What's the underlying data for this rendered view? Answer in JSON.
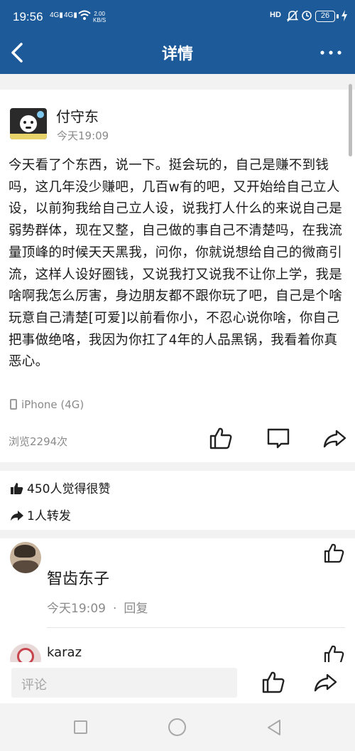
{
  "status_bar": {
    "time": "19:56",
    "signal1": "4G",
    "signal2": "4G",
    "net_speed_value": "2.00",
    "net_speed_unit": "KB/S",
    "hd": "HD",
    "battery": "26"
  },
  "header": {
    "title": "详情"
  },
  "post": {
    "author": "付守东",
    "time": "今天19:09",
    "content": "今天看了个东西，说一下。挺会玩的，自己是赚不到钱吗，这几年没少赚吧，几百w有的吧，又开始给自己立人设，以前狗我给自己立人设，说我打人什么的来说自己是弱势群体，现在又整，自己做的事自己不清楚吗，在我流量顶峰的时候天天黑我，问你，你就说想给自己的微商引流，这样人设好圈钱，又说我打又说我不让你上学，我是啥啊我怎么厉害，身边朋友都不跟你玩了吧，自己是个啥玩意自己清楚[可爱]以前看你小，不忍心说你啥，你自己把事做绝咯，我因为你扛了4年的人品黑锅，我看着你真恶心。",
    "device": "iPhone (4G)",
    "views": "浏览2294次"
  },
  "stats": {
    "likes": "450人觉得很赞",
    "forwards": "1人转发"
  },
  "comments": [
    {
      "name": "智齿东子",
      "time": "今天19:09",
      "dot": "·",
      "reply": "回复"
    },
    {
      "name": "karaz"
    }
  ],
  "bottom_bar": {
    "comment_placeholder": "评论"
  },
  "colors": {
    "header_bg": "#1d5a99",
    "divider": "#f2f2f2",
    "meta_text": "#8a8a8a"
  }
}
